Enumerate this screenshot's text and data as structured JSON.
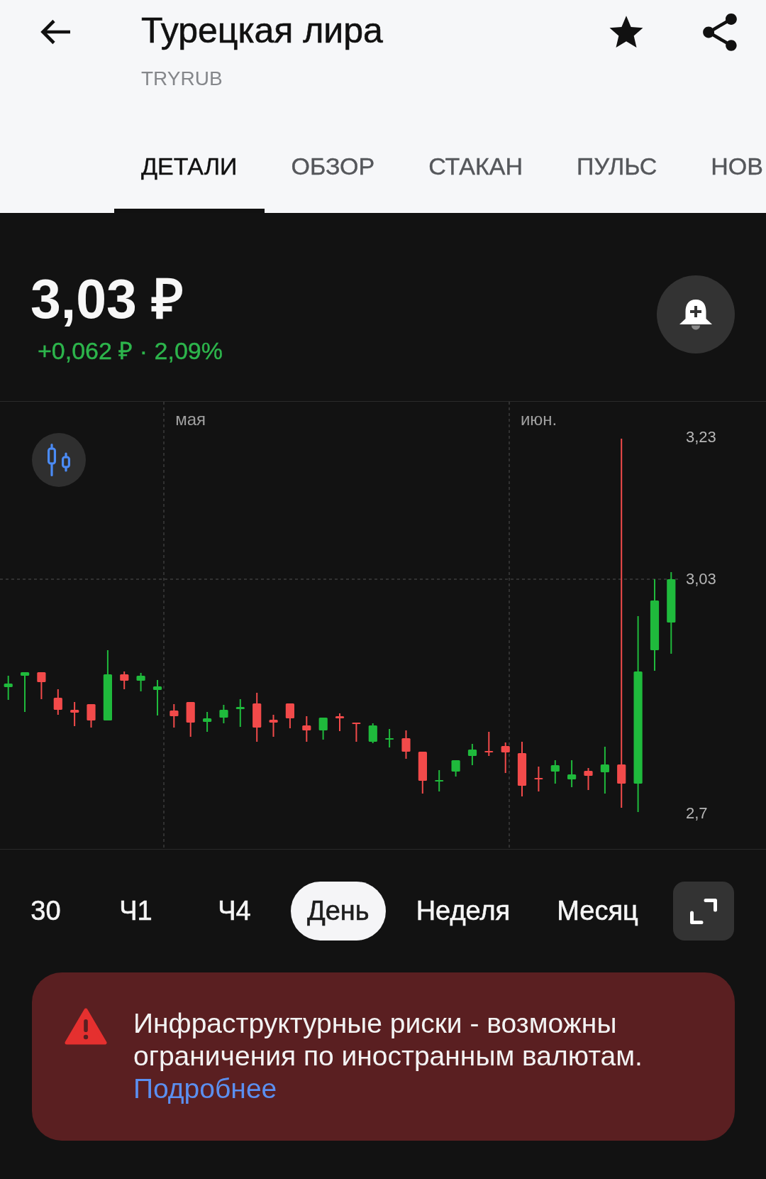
{
  "header": {
    "title": "Турецкая лира",
    "ticker": "TRYRUB",
    "favorite": true
  },
  "tabs": [
    {
      "label": "ДЕТАЛИ",
      "selected": true
    },
    {
      "label": "ОБЗОР",
      "selected": false
    },
    {
      "label": "СТАКАН",
      "selected": false
    },
    {
      "label": "ПУЛЬС",
      "selected": false
    },
    {
      "label": "НОВ",
      "selected": false
    }
  ],
  "quote": {
    "price": "3,03 ₽",
    "change": "+0,062 ₽ · 2,09%"
  },
  "chart": {
    "chart_data": {
      "type": "candlestick",
      "categories": [
        null,
        null,
        null,
        null,
        null,
        null,
        null,
        null,
        null,
        null,
        null,
        "мая",
        null,
        null,
        null,
        null,
        null,
        null,
        null,
        null,
        null,
        null,
        null,
        null,
        null,
        null,
        null,
        null,
        null,
        null,
        null,
        null,
        "июн.",
        null,
        null,
        null,
        null,
        null,
        null,
        null,
        null
      ],
      "ohlc": [
        [
          2.878,
          2.894,
          2.86,
          2.883
        ],
        [
          2.894,
          2.899,
          2.843,
          2.899
        ],
        [
          2.899,
          2.899,
          2.861,
          2.885
        ],
        [
          2.863,
          2.875,
          2.839,
          2.846
        ],
        [
          2.846,
          2.857,
          2.823,
          2.842
        ],
        [
          2.854,
          2.854,
          2.821,
          2.831
        ],
        [
          2.831,
          2.93,
          2.831,
          2.896
        ],
        [
          2.896,
          2.9,
          2.875,
          2.887
        ],
        [
          2.887,
          2.898,
          2.872,
          2.894
        ],
        [
          2.874,
          2.888,
          2.838,
          2.879
        ],
        [
          2.845,
          2.854,
          2.821,
          2.837
        ],
        [
          2.857,
          2.857,
          2.808,
          2.828
        ],
        [
          2.829,
          2.843,
          2.815,
          2.834
        ],
        [
          2.835,
          2.853,
          2.827,
          2.846
        ],
        [
          2.847,
          2.861,
          2.822,
          2.85
        ],
        [
          2.855,
          2.87,
          2.801,
          2.821
        ],
        [
          2.832,
          2.839,
          2.808,
          2.828
        ],
        [
          2.855,
          2.855,
          2.82,
          2.834
        ],
        [
          2.824,
          2.837,
          2.801,
          2.817
        ],
        [
          2.817,
          2.835,
          2.804,
          2.835
        ],
        [
          2.837,
          2.841,
          2.816,
          2.834
        ],
        [
          2.828,
          2.828,
          2.801,
          2.826
        ],
        [
          2.801,
          2.827,
          2.799,
          2.824
        ],
        [
          2.805,
          2.819,
          2.793,
          2.806
        ],
        [
          2.806,
          2.817,
          2.777,
          2.787
        ],
        [
          2.787,
          2.787,
          2.728,
          2.746
        ],
        [
          2.745,
          2.761,
          2.731,
          2.747
        ],
        [
          2.759,
          2.775,
          2.752,
          2.775
        ],
        [
          2.781,
          2.798,
          2.768,
          2.79
        ],
        [
          2.788,
          2.815,
          2.781,
          2.786
        ],
        [
          2.795,
          2.8,
          2.757,
          2.786
        ],
        [
          2.785,
          2.801,
          2.724,
          2.739
        ],
        [
          2.75,
          2.766,
          2.731,
          2.748
        ],
        [
          2.759,
          2.775,
          2.742,
          2.768
        ],
        [
          2.748,
          2.775,
          2.737,
          2.755
        ],
        [
          2.76,
          2.764,
          2.733,
          2.753
        ],
        [
          2.758,
          2.794,
          2.728,
          2.769
        ],
        [
          2.769,
          3.228,
          2.708,
          2.742
        ],
        [
          2.742,
          2.978,
          2.702,
          2.9
        ],
        [
          2.93,
          3.03,
          2.901,
          3.0
        ],
        [
          2.969,
          3.04,
          2.925,
          3.03
        ]
      ],
      "ylim": [
        2.65,
        3.28
      ],
      "yticks": [
        {
          "value": 3.23,
          "label": "3,23"
        },
        {
          "value": 3.03,
          "label": "3,03"
        },
        {
          "value": 2.7,
          "label": "2,7"
        }
      ]
    }
  },
  "periods": [
    {
      "label": "30",
      "selected": false
    },
    {
      "label": "Ч1",
      "selected": false
    },
    {
      "label": "Ч4",
      "selected": false
    },
    {
      "label": "День",
      "selected": true
    },
    {
      "label": "Неделя",
      "selected": false
    },
    {
      "label": "Месяц",
      "selected": false
    }
  ],
  "notice": {
    "text": "Инфраструктурные риски - возможны ограничения по иностранным валютам.",
    "link": "Подробнее"
  }
}
